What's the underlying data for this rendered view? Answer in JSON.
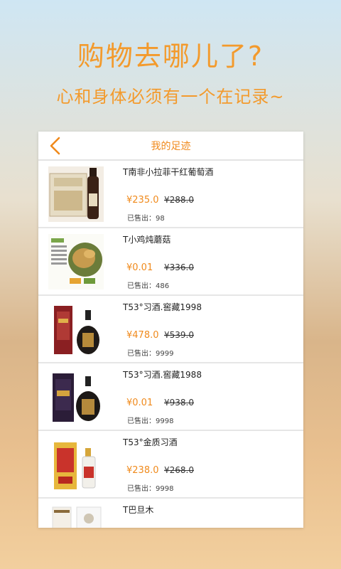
{
  "promo": {
    "headline": "购物去哪儿了?",
    "subline": "心和身体必须有一个在记录~"
  },
  "header": {
    "title": "我的足迹",
    "back_icon": "chevron-left-icon"
  },
  "colors": {
    "accent": "#f08a1c",
    "headline": "#f39a2c"
  },
  "sold_label": "已售出：",
  "items": [
    {
      "name": "T南非小拉菲干红葡萄酒",
      "price": "¥235.0",
      "old_price": "¥288.0",
      "sold": "已售出：98"
    },
    {
      "name": "T小鸡炖蘑菇",
      "price": "¥0.01",
      "old_price": "¥336.0",
      "sold": "已售出：486"
    },
    {
      "name": "T53°习酒.窖藏1998",
      "price": "¥478.0",
      "old_price": "¥539.0",
      "sold": "已售出：9999"
    },
    {
      "name": "T53°习酒.窖藏1988",
      "price": "¥0.01",
      "old_price": "¥938.0",
      "sold": "已售出：9998"
    },
    {
      "name": "T53°金质习酒",
      "price": "¥238.0",
      "old_price": "¥268.0",
      "sold": "已售出：9998"
    },
    {
      "name": "T巴旦木",
      "price": "",
      "old_price": "",
      "sold": ""
    }
  ]
}
